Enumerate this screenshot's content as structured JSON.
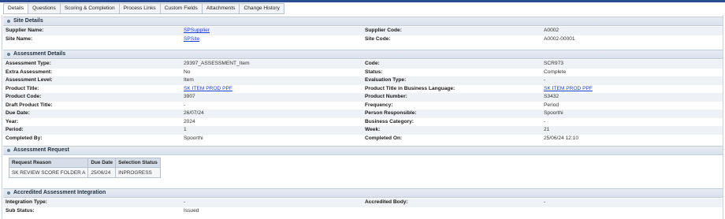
{
  "tabs": [
    "Details",
    "Questions",
    "Scoring & Completion",
    "Process Links",
    "Custom Fields",
    "Attachments",
    "Change History"
  ],
  "site_details": {
    "title": "Site Details",
    "rows": [
      {
        "l1": "Supplier Name:",
        "v1": "SPSupplier",
        "l2": "Supplier Code:",
        "v2": "A0002"
      },
      {
        "l1": "Site Name:",
        "v1": "SPSite",
        "l2": "Site Code:",
        "v2": "A0002-00001"
      }
    ]
  },
  "assessment_details": {
    "title": "Assessment Details",
    "rows": [
      {
        "l1": "Assessment Type:",
        "v1": "29397_ASSESSMENT_Item",
        "l2": "Code:",
        "v2": "SCR973"
      },
      {
        "l1": "Extra Assessment:",
        "v1": "No",
        "l2": "Status:",
        "v2": "Complete"
      },
      {
        "l1": "Assessment Level:",
        "v1": "Item",
        "l2": "Evaluation Type:",
        "v2": "-"
      },
      {
        "l1": "Product Title:",
        "v1": "SK ITEM PROD PPF",
        "l2": "Product Title in Business Language:",
        "v2": "SK ITEM PROD PPF"
      },
      {
        "l1": "Product Code:",
        "v1": "3907",
        "l2": "Product Number:",
        "v2": "S3432"
      },
      {
        "l1": "Draft Product Title:",
        "v1": "-",
        "l2": "Frequency:",
        "v2": "Period"
      },
      {
        "l1": "Due Date:",
        "v1": "26/07/24",
        "l2": "Person Responsible:",
        "v2": "Spoorthi"
      },
      {
        "l1": "Year:",
        "v1": "2024",
        "l2": "Business Category:",
        "v2": "-"
      },
      {
        "l1": "Period:",
        "v1": "1",
        "l2": "Week:",
        "v2": "21"
      },
      {
        "l1": "Completed By:",
        "v1": "Spoorthi",
        "l2": "Completed On:",
        "v2": "25/06/24 12:10"
      }
    ]
  },
  "assessment_request": {
    "title": "Assessment Request",
    "headers": [
      "Request Reason",
      "Due Date",
      "Selection Status"
    ],
    "rows": [
      [
        "SK REVIEW SCORE FOLDER A",
        "25/06/24",
        "INPROGRESS"
      ]
    ]
  },
  "accredited": {
    "title": "Accredited Assessment Integration",
    "rows": [
      {
        "l1": "Integration Type:",
        "v1": "-",
        "l2": "Accredited Body:",
        "v2": "-"
      },
      {
        "l1": "Sub Status:",
        "v1": "Issued",
        "l2": "",
        "v2": ""
      }
    ]
  }
}
